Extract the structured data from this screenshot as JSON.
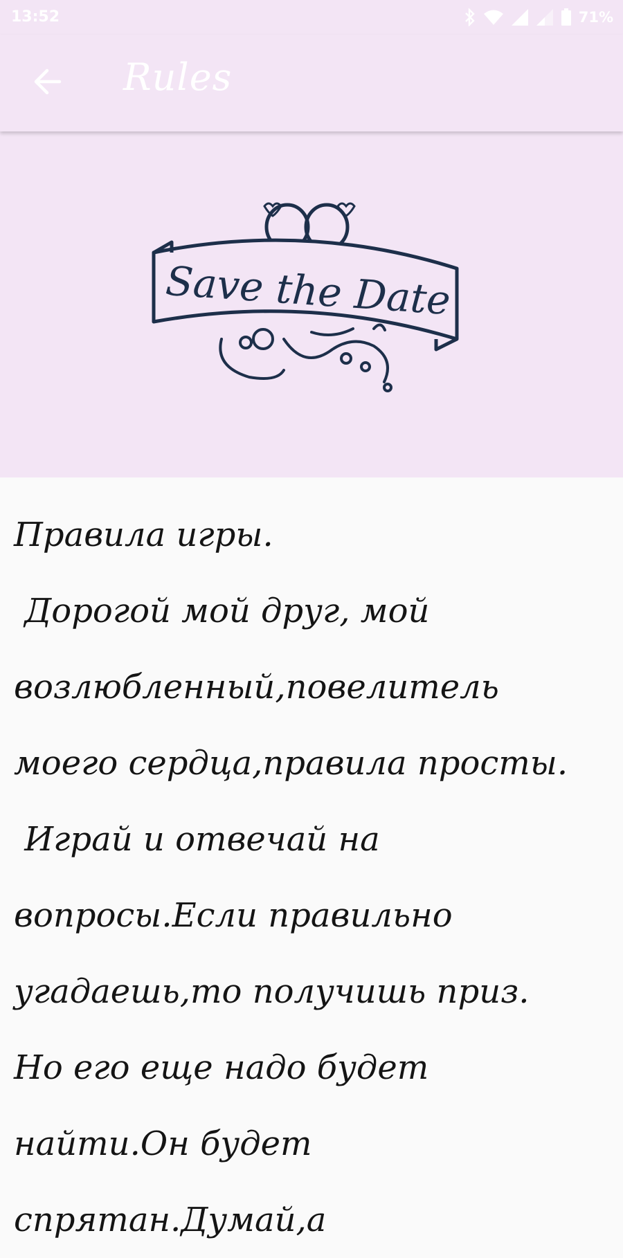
{
  "status_bar": {
    "time": "13:52",
    "battery": "71%",
    "icons": [
      "bluetooth-icon",
      "wifi-icon",
      "signal-icon",
      "signal-weak-icon",
      "battery-icon"
    ]
  },
  "app_bar": {
    "title": "Rules",
    "back_icon": "arrow-back-icon"
  },
  "banner": {
    "text": "Save the Date",
    "icon": "wedding-rings-icon"
  },
  "rules_text": "Правила игры.\n Дорогой мой друг, мой возлюбленный,повелитель моего сердца,правила просты.\n Играй и отвечай на вопросы.Если правильно угадаешь,то получишь приз. Но его еще надо будет найти.Он будет спрятан.Думай,а",
  "colors": {
    "app_bar_bg": "#f3e5f5",
    "banner_ink": "#1d2f4a",
    "text": "#141414",
    "page_bg": "#fafafa"
  }
}
